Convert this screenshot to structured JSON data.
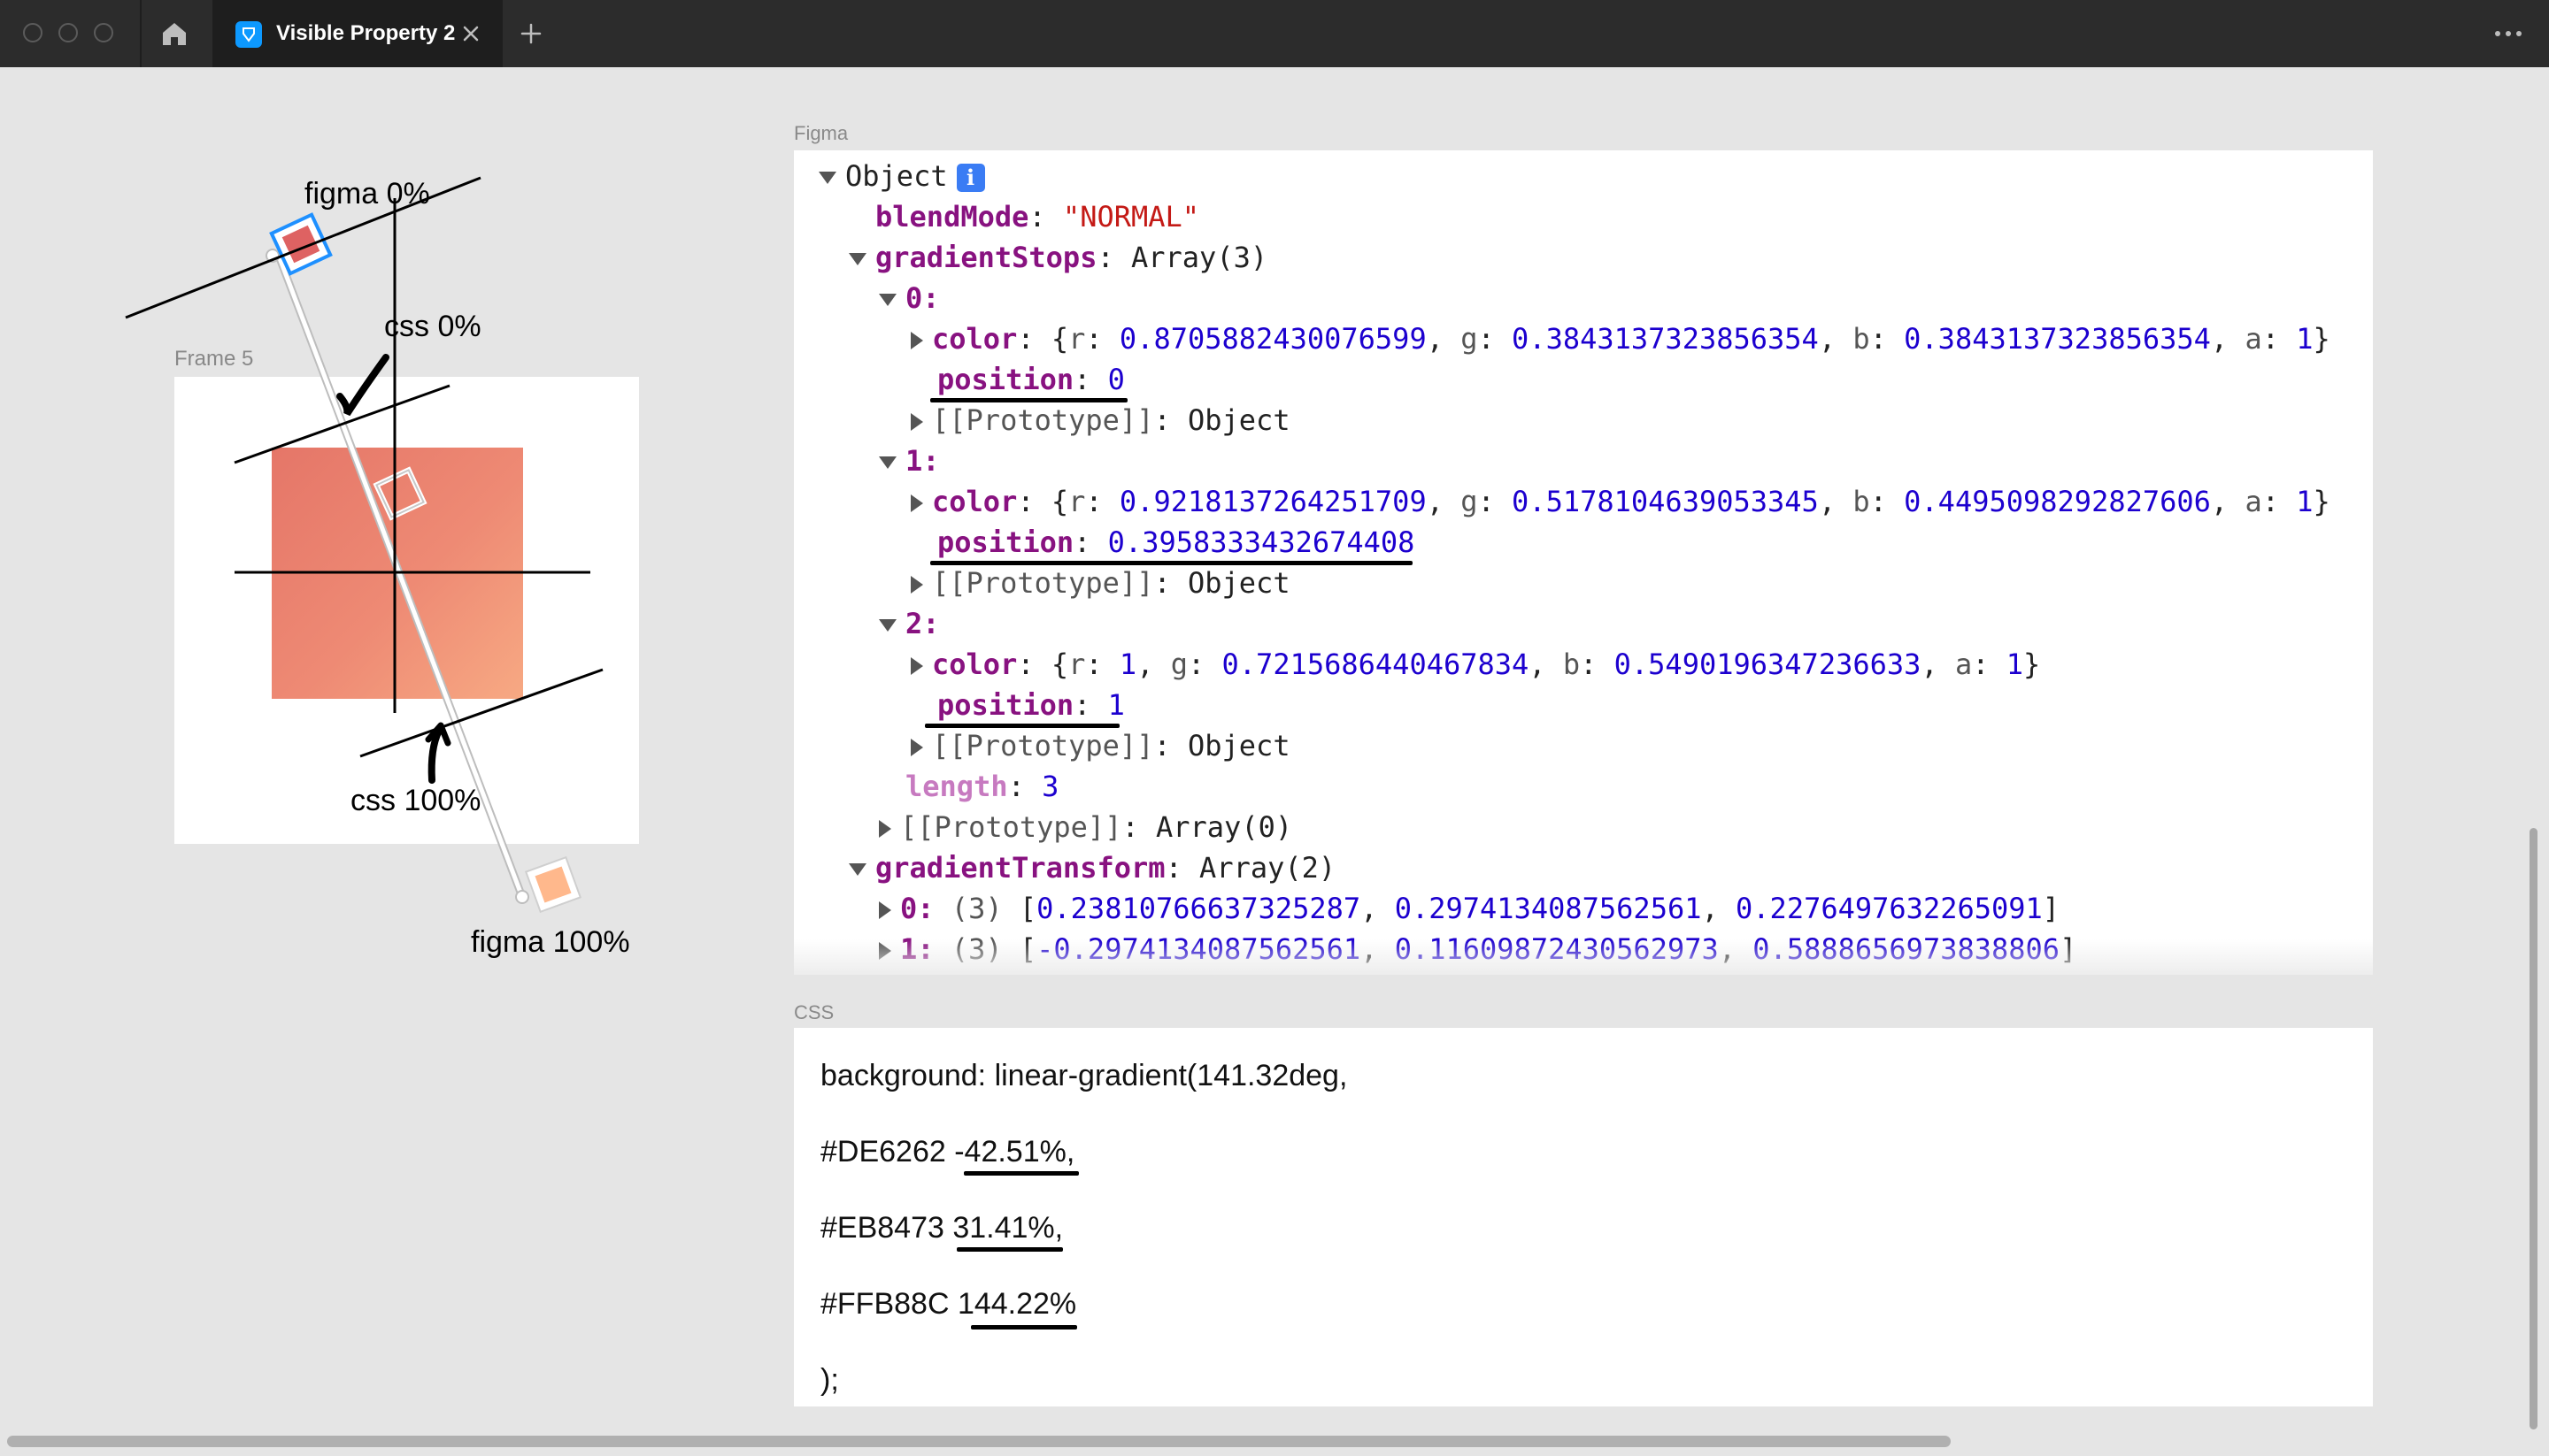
{
  "window": {
    "tab_title": "Visible Property 2",
    "icons": {
      "home": "home-icon",
      "tab": "figma-file-icon",
      "close": "close-icon",
      "add": "plus-icon",
      "more": "more-icon"
    }
  },
  "canvas": {
    "frame_label": "Frame 5",
    "annotations": {
      "figma_start": "figma 0%",
      "css_start": "css 0%",
      "css_end": "css 100%",
      "figma_end": "figma 100%"
    },
    "colors": {
      "stop0": "#DE6262",
      "stop1": "#EB8473",
      "stop2": "#FFB88C",
      "handle_selected": "#1e90ff"
    }
  },
  "figma_panel": {
    "label": "Figma",
    "object_label": "Object",
    "info_badge": "i",
    "blendMode_key": "blendMode",
    "blendMode_value": "\"NORMAL\"",
    "gradientStops_key": "gradientStops",
    "gradientStops_summary": "Array(3)",
    "stops": [
      {
        "index": "0",
        "r": "0.8705882430076599",
        "g": "0.3843137323856354",
        "b": "0.3843137323856354",
        "a": "1",
        "position": "0"
      },
      {
        "index": "1",
        "r": "0.9218137264251709",
        "g": "0.5178104639053345",
        "b": "0.4495098292827606",
        "a": "1",
        "position": "0.3958333432674408"
      },
      {
        "index": "2",
        "r": "1",
        "g": "0.7215686440467834",
        "b": "0.5490196347236633",
        "a": "1",
        "position": "1"
      }
    ],
    "color_key": "color",
    "position_key": "position",
    "prototype_label": "[[Prototype]]",
    "prototype_object": "Object",
    "length_key": "length",
    "length_value": "3",
    "array_prototype_value": "Array(0)",
    "gradientTransform_key": "gradientTransform",
    "gradientTransform_summary": "Array(2)",
    "transform_rows": [
      {
        "index": "0",
        "count": "(3)",
        "v1": "0.23810766637325287",
        "v2": "0.2974134087562561",
        "v3": "0.2276497632265091"
      },
      {
        "index": "1",
        "count": "(3)",
        "v1": "-0.2974134087562561",
        "v2": "0.11609872430562973",
        "v3": "0.5888656973838806"
      }
    ]
  },
  "css_panel": {
    "label": "CSS",
    "lines": [
      "background: linear-gradient(141.32deg,",
      "#DE6262 -42.51%,",
      "#EB8473 31.41%,",
      "#FFB88C 144.22%",
      ");"
    ]
  }
}
